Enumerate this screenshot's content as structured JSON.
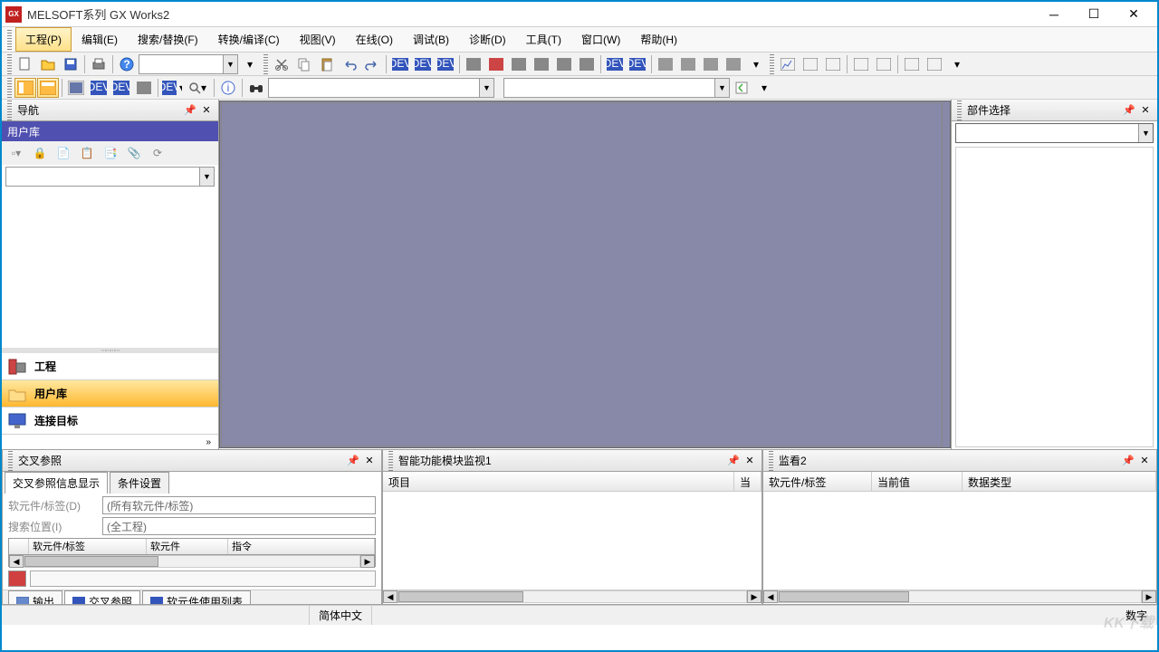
{
  "title": "MELSOFT系列 GX Works2",
  "menu": {
    "items": [
      "工程(P)",
      "编辑(E)",
      "搜索/替换(F)",
      "转换/编译(C)",
      "视图(V)",
      "在线(O)",
      "调试(B)",
      "诊断(D)",
      "工具(T)",
      "窗口(W)",
      "帮助(H)"
    ],
    "active_index": 0
  },
  "nav": {
    "title": "导航",
    "subtitle": "用户库",
    "categories": [
      "工程",
      "用户库",
      "连接目标"
    ],
    "selected_index": 1
  },
  "parts": {
    "title": "部件选择"
  },
  "xref": {
    "title": "交叉参照",
    "tabs": [
      "交叉参照信息显示",
      "条件设置"
    ],
    "active_tab": 0,
    "label_device": "软元件/标签(D)",
    "value_device": "(所有软元件/标签)",
    "label_search": "搜索位置(I)",
    "value_search": "(全工程)",
    "grid_cols": [
      "软元件/标签",
      "软元件",
      "指令"
    ]
  },
  "bottom_tabs": {
    "items": [
      "输出",
      "交叉参照",
      "软元件使用列表"
    ],
    "active_index": 1
  },
  "monitor": {
    "title": "智能功能模块监视1",
    "cols": [
      "项目",
      "当"
    ]
  },
  "watch": {
    "title": "监看2",
    "cols": [
      "软元件/标签",
      "当前值",
      "数据类型"
    ]
  },
  "status": {
    "lang": "简体中文",
    "right": "数字"
  },
  "watermark": "KK下载"
}
